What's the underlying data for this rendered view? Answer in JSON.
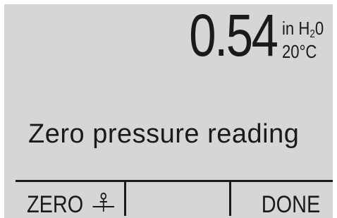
{
  "display": {
    "reading_value": "0.54",
    "unit_prefix": "in H",
    "unit_sub": "2",
    "unit_suffix": "0",
    "temperature": "20°C"
  },
  "message": "Zero pressure reading",
  "softkeys": {
    "left_label": "ZERO",
    "left_icon": "zero-symbol-icon",
    "middle_label": "",
    "right_label": "DONE"
  },
  "colors": {
    "lcd_background": "#d6d6d6",
    "lcd_text": "#1a1a1a"
  }
}
